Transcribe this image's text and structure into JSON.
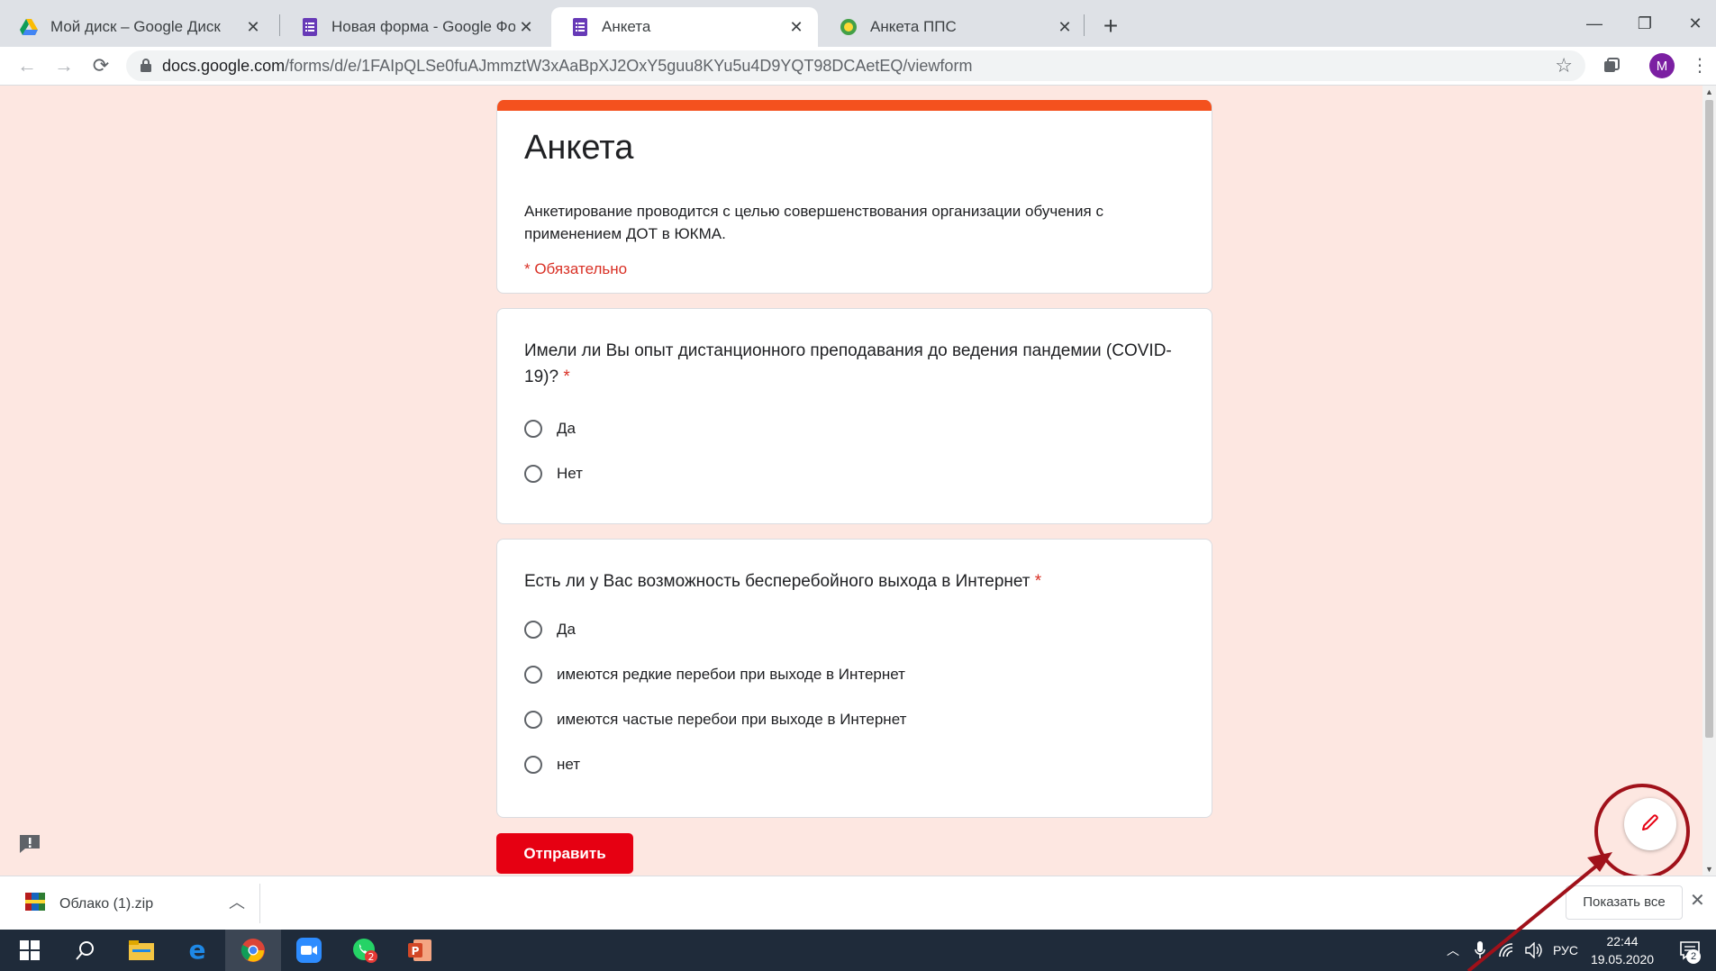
{
  "browser": {
    "tabs": [
      {
        "title": "Мой диск – Google Диск",
        "icon": "google-drive-icon",
        "active": false
      },
      {
        "title": "Новая форма - Google Формы",
        "icon": "google-forms-icon",
        "active": false
      },
      {
        "title": "Анкета",
        "icon": "google-forms-icon",
        "active": true
      },
      {
        "title": "Анкета ППС",
        "icon": "site-favicon-icon",
        "active": false
      }
    ],
    "url_host": "docs.google.com",
    "url_path": "/forms/d/e/1FAIpQLSe0fuAJmmztW3xAaBpXJ2OxY5guu8KYu5u4D9YQT98DCAetEQ/viewform",
    "profile_initial": "M"
  },
  "form": {
    "title": "Анкета",
    "description": "Анкетирование проводится с целью совершенствования организации обучения с применением ДОТ в ЮКМА.",
    "required_note": "* Обязательно",
    "questions": [
      {
        "text": "Имели ли Вы опыт дистанционного преподавания до ведения пандемии (COVID-19)?",
        "required_mark": "*",
        "options": [
          "Да",
          "Нет"
        ]
      },
      {
        "text": "Есть ли у Вас возможность бесперебойного выхода в Интернет",
        "required_mark": "*",
        "options": [
          "Да",
          "имеются редкие перебои при выходе в Интернет",
          "имеются частые перебои при выходе в Интернет",
          "нет"
        ]
      }
    ],
    "submit_label": "Отправить"
  },
  "downloads": {
    "file_name": "Облако (1).zip",
    "show_all_label": "Показать все"
  },
  "taskbar": {
    "language": "РУС",
    "time": "22:44",
    "date": "19.05.2020",
    "notification_count": "2",
    "whatsapp_badge": "2"
  },
  "colors": {
    "page_bg": "#fde7e1",
    "form_accent": "#f4511e",
    "submit_bg": "#e60012",
    "required": "#d93025",
    "annotation": "#a0111a"
  }
}
